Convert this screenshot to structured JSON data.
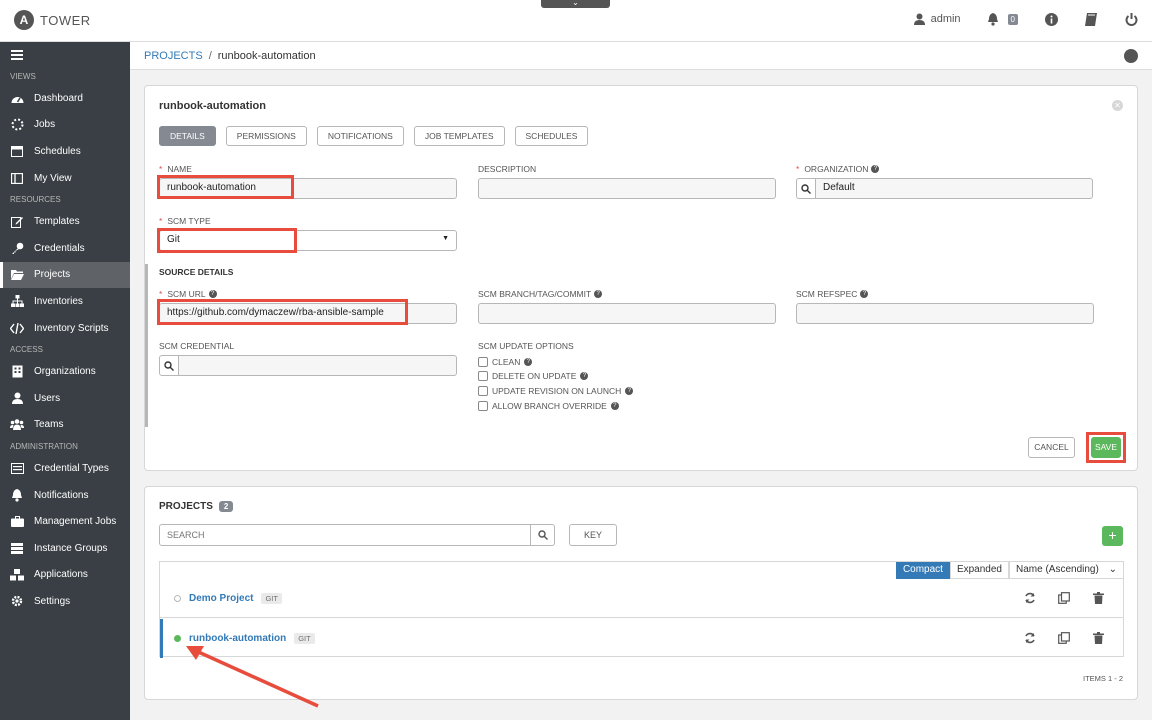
{
  "app": {
    "logo_letter": "A",
    "name": "TOWER"
  },
  "topbar": {
    "user": "admin",
    "notifications_count": "0"
  },
  "sidebar": {
    "sections": [
      {
        "label": "VIEWS",
        "items": [
          {
            "label": "Dashboard",
            "icon": "dashboard-icon"
          },
          {
            "label": "Jobs",
            "icon": "jobs-icon"
          },
          {
            "label": "Schedules",
            "icon": "calendar-icon"
          },
          {
            "label": "My View",
            "icon": "my-view-icon"
          }
        ]
      },
      {
        "label": "RESOURCES",
        "items": [
          {
            "label": "Templates",
            "icon": "pencil-icon"
          },
          {
            "label": "Credentials",
            "icon": "key-icon"
          },
          {
            "label": "Projects",
            "icon": "folder-icon",
            "active": true
          },
          {
            "label": "Inventories",
            "icon": "sitemap-icon"
          },
          {
            "label": "Inventory Scripts",
            "icon": "code-icon"
          }
        ]
      },
      {
        "label": "ACCESS",
        "items": [
          {
            "label": "Organizations",
            "icon": "building-icon"
          },
          {
            "label": "Users",
            "icon": "user-icon"
          },
          {
            "label": "Teams",
            "icon": "team-icon"
          }
        ]
      },
      {
        "label": "ADMINISTRATION",
        "items": [
          {
            "label": "Credential Types",
            "icon": "list-icon"
          },
          {
            "label": "Notifications",
            "icon": "bell-icon"
          },
          {
            "label": "Management Jobs",
            "icon": "briefcase-icon"
          },
          {
            "label": "Instance Groups",
            "icon": "server-icon"
          },
          {
            "label": "Applications",
            "icon": "cubes-icon"
          },
          {
            "label": "Settings",
            "icon": "gear-icon"
          }
        ]
      }
    ]
  },
  "breadcrumb": {
    "link": "PROJECTS",
    "separator": "/",
    "current": "runbook-automation"
  },
  "form": {
    "title": "runbook-automation",
    "tabs": [
      "DETAILS",
      "PERMISSIONS",
      "NOTIFICATIONS",
      "JOB TEMPLATES",
      "SCHEDULES"
    ],
    "name_label": "NAME",
    "name_value": "runbook-automation",
    "description_label": "DESCRIPTION",
    "description_value": "",
    "organization_label": "ORGANIZATION",
    "organization_value": "Default",
    "scm_type_label": "SCM TYPE",
    "scm_type_value": "Git",
    "source_details_title": "SOURCE DETAILS",
    "scm_url_label": "SCM URL",
    "scm_url_value": "https://github.com/dymaczew/rba-ansible-sample",
    "scm_branch_label": "SCM BRANCH/TAG/COMMIT",
    "scm_refspec_label": "SCM REFSPEC",
    "scm_credential_label": "SCM CREDENTIAL",
    "scm_update_options_label": "SCM UPDATE OPTIONS",
    "options": [
      "CLEAN",
      "DELETE ON UPDATE",
      "UPDATE REVISION ON LAUNCH",
      "ALLOW BRANCH OVERRIDE"
    ],
    "cancel_label": "CANCEL",
    "save_label": "SAVE"
  },
  "projects_list": {
    "title": "PROJECTS",
    "count": "2",
    "search_placeholder": "SEARCH",
    "key_label": "KEY",
    "add_label": "+",
    "view_compact": "Compact",
    "view_expanded": "Expanded",
    "sort_label": "Name (Ascending)",
    "rows": [
      {
        "name": "Demo Project",
        "scm": "GIT",
        "status": "idle"
      },
      {
        "name": "runbook-automation",
        "scm": "GIT",
        "status": "successful"
      }
    ],
    "items_count": "ITEMS  1 - 2"
  },
  "colors": {
    "sidebar_bg": "#393f44",
    "accent_blue": "#337ab7",
    "success_green": "#5cb85c",
    "annotation_red": "#e74c3c"
  }
}
